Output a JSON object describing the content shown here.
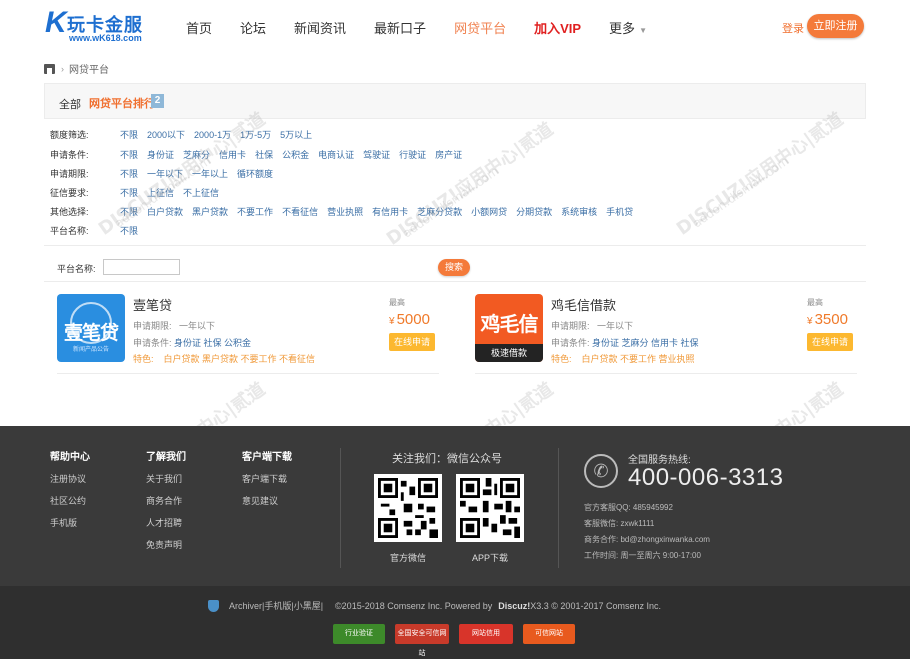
{
  "header": {
    "logo_letter": "K",
    "logo_name": "玩卡金服",
    "logo_url": "www.wK618.com",
    "nav": [
      {
        "label": "首页",
        "style": "normal",
        "gap": 0
      },
      {
        "label": "论坛",
        "style": "normal"
      },
      {
        "label": "新闻资讯",
        "style": "normal"
      },
      {
        "label": "最新口子",
        "style": "normal"
      },
      {
        "label": "网贷平台",
        "style": "orange"
      },
      {
        "label": "加入VIP",
        "style": "red"
      },
      {
        "label": "更多",
        "style": "normal"
      }
    ],
    "login_label": "登录",
    "register_label": "立即注册"
  },
  "breadcrumb": {
    "current": "网贷平台",
    "separator": "›"
  },
  "tabbar": {
    "all_label": "全部",
    "rank_label": "网贷平台排行",
    "badge": "2"
  },
  "filters": [
    {
      "label": "额度筛选:",
      "options": [
        "不限",
        "2000以下",
        "2000-1万",
        "1万-5万",
        "5万以上"
      ]
    },
    {
      "label": "申请条件:",
      "options": [
        "不限",
        "身份证",
        "芝麻分",
        "信用卡",
        "社保",
        "公积金",
        "电商认证",
        "驾驶证",
        "行驶证",
        "房产证"
      ]
    },
    {
      "label": "申请期限:",
      "options": [
        "不限",
        "一年以下",
        "一年以上",
        "循环额度"
      ]
    },
    {
      "label": "征信要求:",
      "options": [
        "不限",
        "上征信",
        "不上征信"
      ]
    },
    {
      "label": "其他选择:",
      "options": [
        "不限",
        "白户贷款",
        "黑户贷款",
        "不要工作",
        "不看征信",
        "营业执照",
        "有信用卡",
        "芝麻分贷款",
        "小额网贷",
        "分期贷款",
        "系统审核",
        "手机贷"
      ]
    },
    {
      "label": "平台名称:",
      "options": [
        "不限"
      ]
    }
  ],
  "search": {
    "label": "平台名称:",
    "value": "",
    "button": "搜索"
  },
  "products": [
    {
      "name": "壹笔贷",
      "logo_text": "壹笔贷",
      "logo_sub": "新闻产品公告",
      "term_label": "申请期限:",
      "term": "一年以下",
      "cond_label": "申请条件:",
      "conditions": "身份证 社保 公积金",
      "feature_label": "特色:",
      "features": "白户贷款 黑户贷款 不要工作 不看征信",
      "max_label": "最高",
      "currency": "¥",
      "amount": "5000",
      "apply_label": "在线申请"
    },
    {
      "name": "鸡毛信借款",
      "logo_text": "鸡毛信",
      "logo_sub": "极速借款",
      "term_label": "申请期限:",
      "term": "一年以下",
      "cond_label": "申请条件:",
      "conditions": "身份证 芝麻分 信用卡 社保",
      "feature_label": "特色:",
      "features": "白户贷款 不要工作 营业执照",
      "max_label": "最高",
      "currency": "¥",
      "amount": "3500",
      "apply_label": "在线申请"
    }
  ],
  "footer": {
    "cols": [
      {
        "title": "帮助中心",
        "links": [
          "注册协议",
          "社区公约",
          "手机版"
        ]
      },
      {
        "title": "了解我们",
        "links": [
          "关于我们",
          "商务合作",
          "人才招聘",
          "免责声明"
        ]
      },
      {
        "title": "客户端下载",
        "links": [
          "客户端下载",
          "意见建议"
        ]
      }
    ],
    "follow_title": "关注我们：微信公众号",
    "qr_captions": [
      "官方微信",
      "APP下载"
    ],
    "hotline_title": "全国服务热线:",
    "hotline": "400-006-3313",
    "contact": [
      {
        "label": "官方客服QQ:",
        "value": "485945992"
      },
      {
        "label": "客服微信:",
        "value": "zxwk1111"
      },
      {
        "label": "商务合作:",
        "value": "bd@zhongxinwanka.com"
      },
      {
        "label": "工作时间:",
        "value": "周一至周六 9:00-17:00"
      }
    ]
  },
  "bottom": {
    "links": [
      "Archiver",
      "|手机版",
      "|小黑屋",
      "|"
    ],
    "copyright": "©2015-2018  Comsenz Inc.  Powered by",
    "discuz": "Discuz!",
    "version": "X3.3 © 2001-2017 Comsenz Inc.",
    "badges": [
      "行业验证",
      "全国安全可信网站",
      "网站信用",
      "可信网站"
    ]
  },
  "watermark": {
    "line1": "DISCUZ!应用中心|贰道",
    "line2": "addon.dismall.com"
  },
  "colors": {
    "accent": "#f47a3a",
    "link": "#3a6ea5",
    "footer": "#3a3a3a",
    "brand": "#1e6fd0"
  }
}
